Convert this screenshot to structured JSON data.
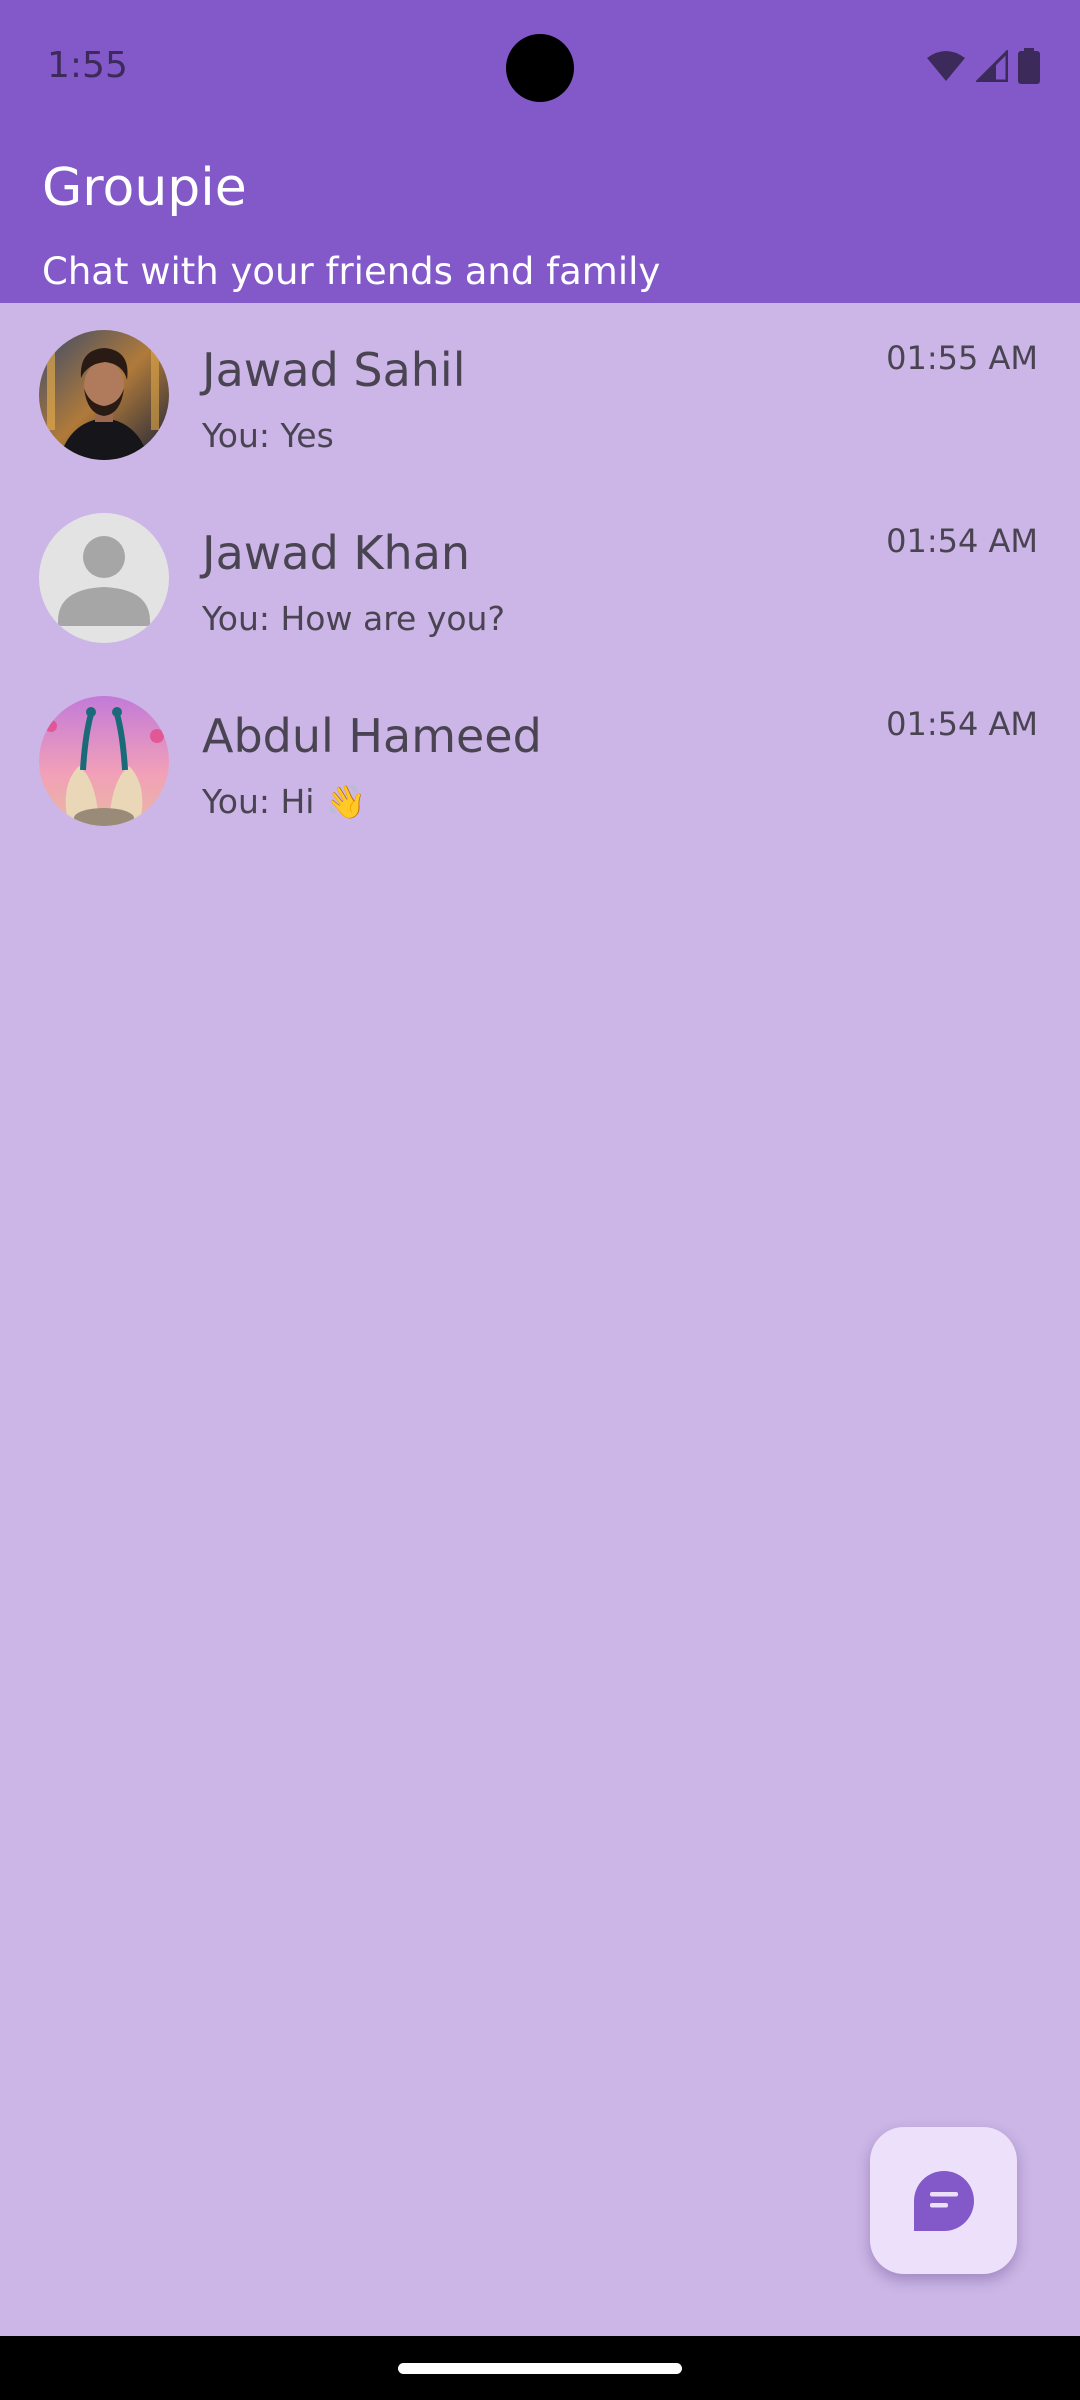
{
  "status_bar": {
    "time": "1:55"
  },
  "app_bar": {
    "title": "Groupie",
    "subtitle": "Chat with your friends and family"
  },
  "chats": [
    {
      "name": "Jawad Sahil",
      "preview": "You: Yes",
      "time": "01:55 AM",
      "avatar": "profile-photo-man"
    },
    {
      "name": "Jawad Khan",
      "preview": "You: How are you?",
      "time": "01:54 AM",
      "avatar": "default-person-icon"
    },
    {
      "name": "Abdul Hameed",
      "preview": "You: Hi 👋",
      "time": "01:54 AM",
      "avatar": "profile-photo-peacocks"
    }
  ],
  "fab": {
    "icon": "new-chat-icon"
  },
  "colors": {
    "header": "#8359c9",
    "background": "#cbb6e7",
    "fab": "#ede0fb",
    "accent": "#8359c9",
    "text": "#4a4452"
  }
}
